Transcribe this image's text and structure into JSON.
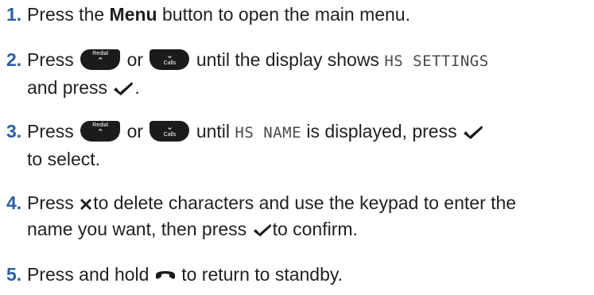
{
  "steps": [
    {
      "number": "1.",
      "pre": "Press the ",
      "bold": "Menu",
      "post": " button to open the main menu."
    },
    {
      "number": "2.",
      "text_press": "Press",
      "text_or": "or",
      "text_until": "until the display shows",
      "display_text": "HS SETTINGS",
      "text_and_press": "and press",
      "text_end": "."
    },
    {
      "number": "3.",
      "text_press": "Press",
      "text_or": "or",
      "text_until": "until",
      "display_text": "HS NAME",
      "text_displayed": "is displayed, press",
      "text_select": "to select."
    },
    {
      "number": "4.",
      "text_press": "Press",
      "text_delete": "to delete characters and use the keypad to enter the",
      "text_name": "name you want, then press",
      "text_confirm": "to confirm."
    },
    {
      "number": "5.",
      "text_hold": "Press and hold",
      "text_return": "to return to standby."
    }
  ],
  "keys": {
    "redial_label": "Redial",
    "calls_label": "Calls",
    "up_arrow": "^",
    "down_arrow": "v"
  },
  "icons": {
    "up_key": "redial-up-key",
    "down_key": "calls-down-key",
    "select": "checkmark-icon",
    "delete": "x-delete-icon",
    "end": "end-call-icon"
  },
  "colors": {
    "step_number": "#2b5fa3",
    "text": "#231f20",
    "key_body": "#1b1b1b"
  }
}
